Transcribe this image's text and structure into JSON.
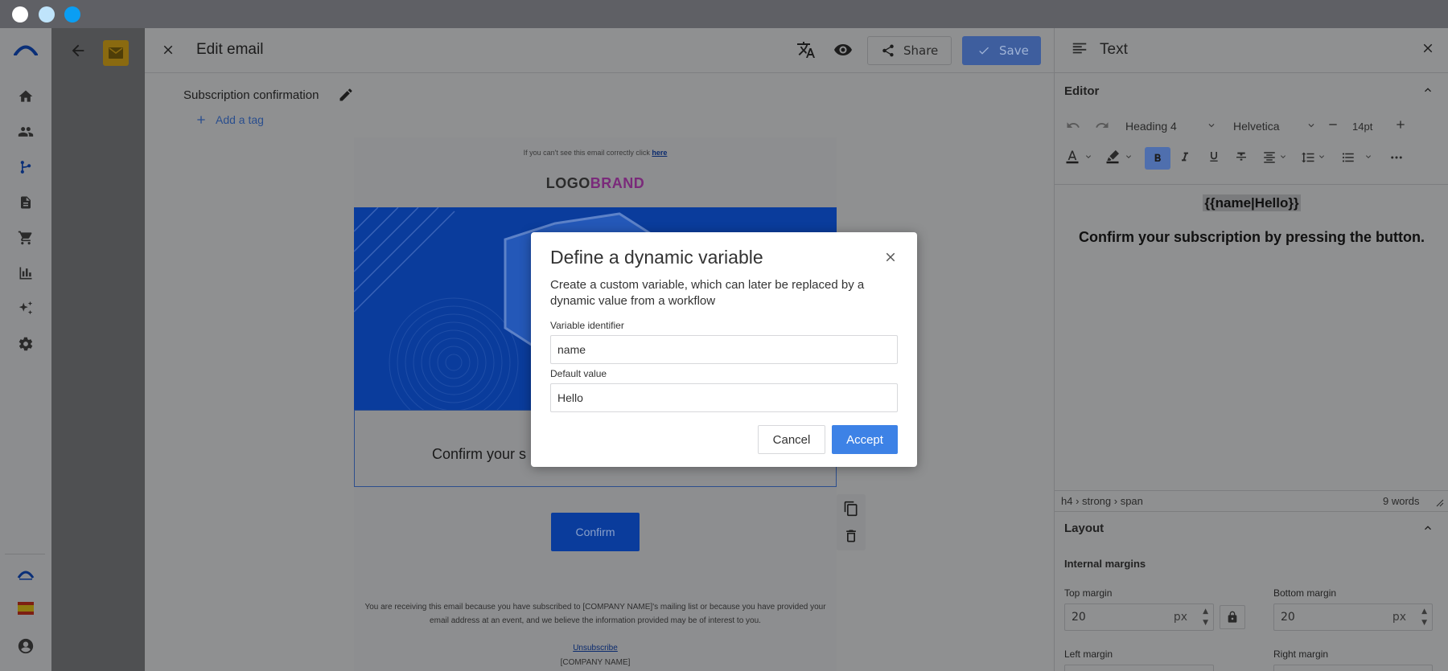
{
  "window": {
    "dots": [
      "#ffffff",
      "#bfe4fb",
      "#0a9ef3"
    ]
  },
  "app_sidebar": {
    "items": [
      "home-icon",
      "contacts-icon",
      "workflows-icon",
      "documents-icon",
      "cart-icon",
      "analytics-icon",
      "ai-sparkle-icon",
      "settings-icon"
    ],
    "bottom": [
      "brand-logo-icon",
      "spain-flag-icon",
      "user-icon"
    ]
  },
  "editor": {
    "title": "Edit email",
    "share_label": "Share",
    "save_label": "Save",
    "subject": "Subscription confirmation",
    "add_tag": "Add a tag"
  },
  "email": {
    "preheader": "If you can't see this email correctly click",
    "preheader_link": "here",
    "logo_part1": "LOGO",
    "logo_part2": "BRAND",
    "body_text": "Confirm your s",
    "confirm_button": "Confirm",
    "footer_text": "You are receiving this email because you have subscribed to [COMPANY NAME]'s mailing list or because you have provided your email address at an event, and we believe the information provided may be of interest to you.",
    "unsubscribe": "Unsubscribe",
    "company": "[COMPANY NAME]"
  },
  "panel": {
    "title": "Text",
    "editor_section": "Editor",
    "block_format": "Heading 4",
    "font_family": "Helvetica",
    "font_size": "14pt",
    "content_heading": "{{name|Hello}}",
    "content_body": "Confirm your subscription by pressing the button.",
    "path": "h4 › strong › span",
    "word_count": "9 words",
    "layout_section": "Layout",
    "internal_margins": "Internal margins",
    "top_margin_label": "Top margin",
    "top_margin_value": "20",
    "bottom_margin_label": "Bottom margin",
    "bottom_margin_value": "20",
    "unit": "px",
    "left_margin_label": "Left margin",
    "right_margin_label": "Right margin"
  },
  "modal": {
    "title": "Define a dynamic variable",
    "description": "Create a custom variable, which can later be replaced by a dynamic value from a workflow",
    "identifier_label": "Variable identifier",
    "identifier_value": "name",
    "default_label": "Default value",
    "default_value": "Hello",
    "cancel": "Cancel",
    "accept": "Accept",
    "accent": "#3d82e6"
  }
}
